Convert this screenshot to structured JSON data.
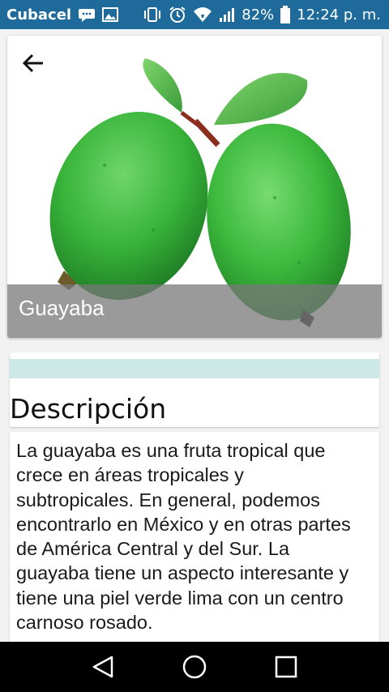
{
  "status_bar": {
    "carrier": "Cubacel",
    "battery": "82%",
    "time": "12:24 p. m.",
    "background": "#1e6a9a"
  },
  "header": {
    "title": "Guayaba",
    "back_icon": "arrow-left-icon",
    "image": "guava-fruit-image"
  },
  "description": {
    "heading": "Descripción",
    "accent_strip": "#cde9e6",
    "body": "La guayaba es una fruta tropical que crece en áreas tropicales y subtropicales. En general, podemos encontrarlo en México y en otras partes de América Central y del Sur. La guayaba tiene un aspecto interesante y tiene una piel verde lima con un centro carnoso rosado."
  },
  "nav_bar": {
    "back_icon": "triangle-back-icon",
    "home_icon": "circle-home-icon",
    "recents_icon": "square-recents-icon"
  }
}
